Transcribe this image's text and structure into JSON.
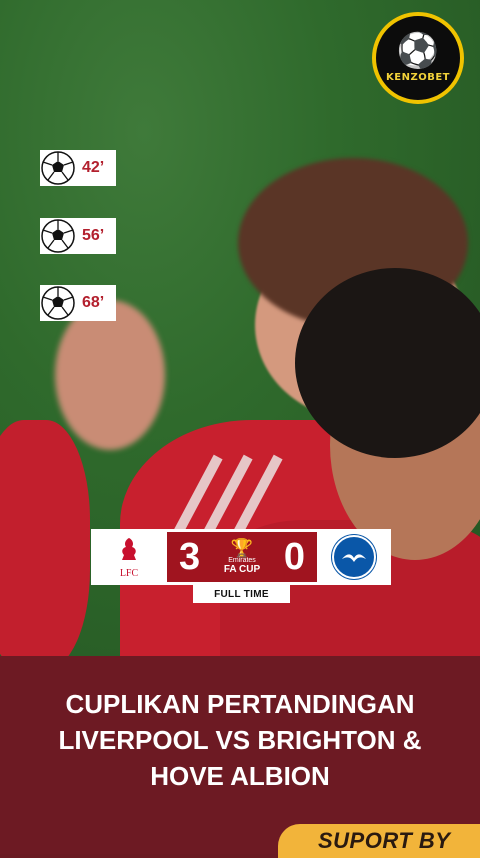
{
  "brand": {
    "name": "KENZOBET",
    "icon": "soccer-ball-icon"
  },
  "goals": [
    {
      "minute": "42’"
    },
    {
      "minute": "56’"
    },
    {
      "minute": "68’"
    }
  ],
  "scoreboard": {
    "home_crest_text": "LFC",
    "home_score": "3",
    "away_score": "0",
    "competition_line1": "Emirates",
    "competition_line2": "FA CUP",
    "status": "FULL TIME"
  },
  "headline": {
    "line1": "CUPLIKAN PERTANDINGAN",
    "line2": "LIVERPOOL VS BRIGHTON &",
    "line3": "HOVE ALBION"
  },
  "support": {
    "label": "SUPORT BY"
  },
  "colors": {
    "accent": "#f0c300",
    "liverpool_red": "#c8102e",
    "brighton_blue": "#0a57a8",
    "banner": "#6d1a23"
  }
}
